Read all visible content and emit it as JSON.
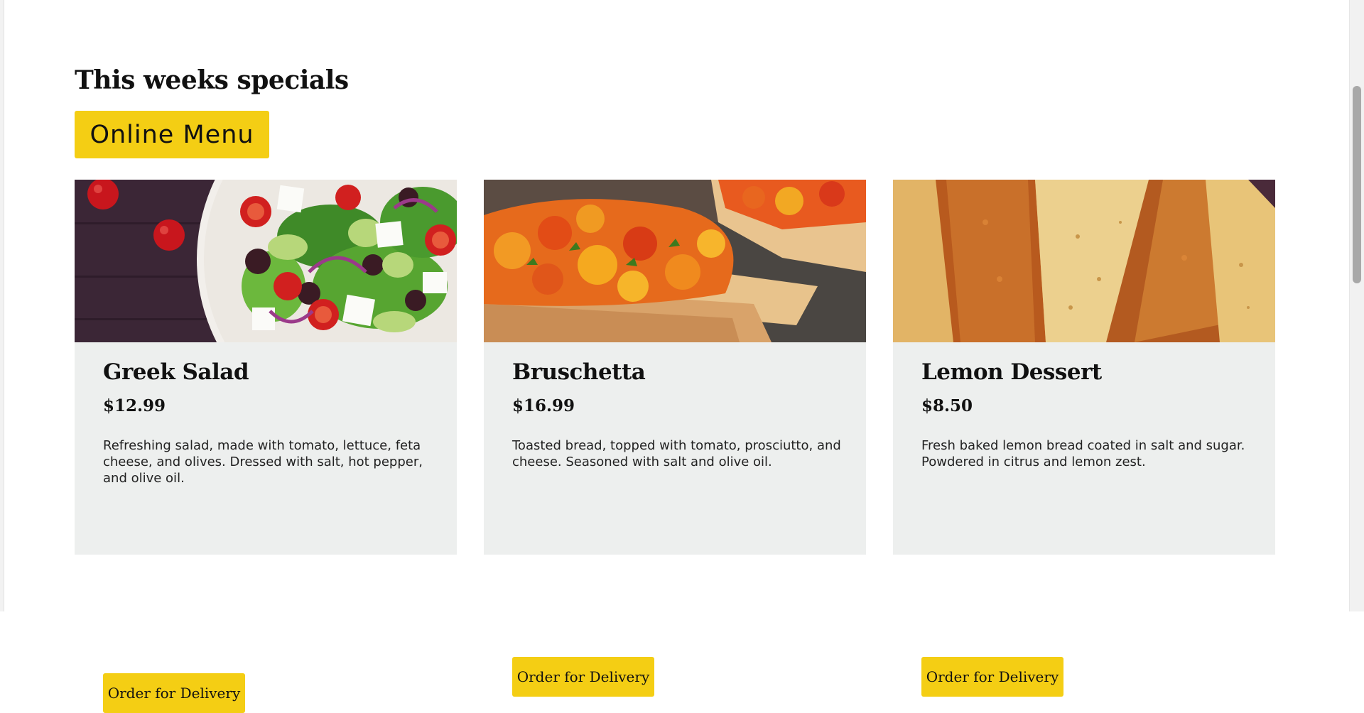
{
  "specials": {
    "heading": "This weeks specials",
    "menu_button_label": "Online Menu"
  },
  "cards": [
    {
      "title": "Greek Salad",
      "price": "$12.99",
      "description": "Refreshing salad, made with tomato, lettuce, feta cheese, and olives. Dressed with salt, hot pepper, and olive oil.",
      "button_label": "Order for Delivery"
    },
    {
      "title": "Bruschetta",
      "price": "$16.99",
      "description": "Toasted bread, topped with tomato, prosciutto, and cheese. Seasoned with salt and olive oil.",
      "button_label": "Order for Delivery"
    },
    {
      "title": "Lemon Dessert",
      "price": "$8.50",
      "description": "Fresh baked lemon bread coated in salt and sugar. Powdered in citrus and lemon zest.",
      "button_label": "Order for Delivery"
    }
  ],
  "colors": {
    "accent": "#f4ce14",
    "card_background": "#edefee",
    "text": "#111111"
  }
}
